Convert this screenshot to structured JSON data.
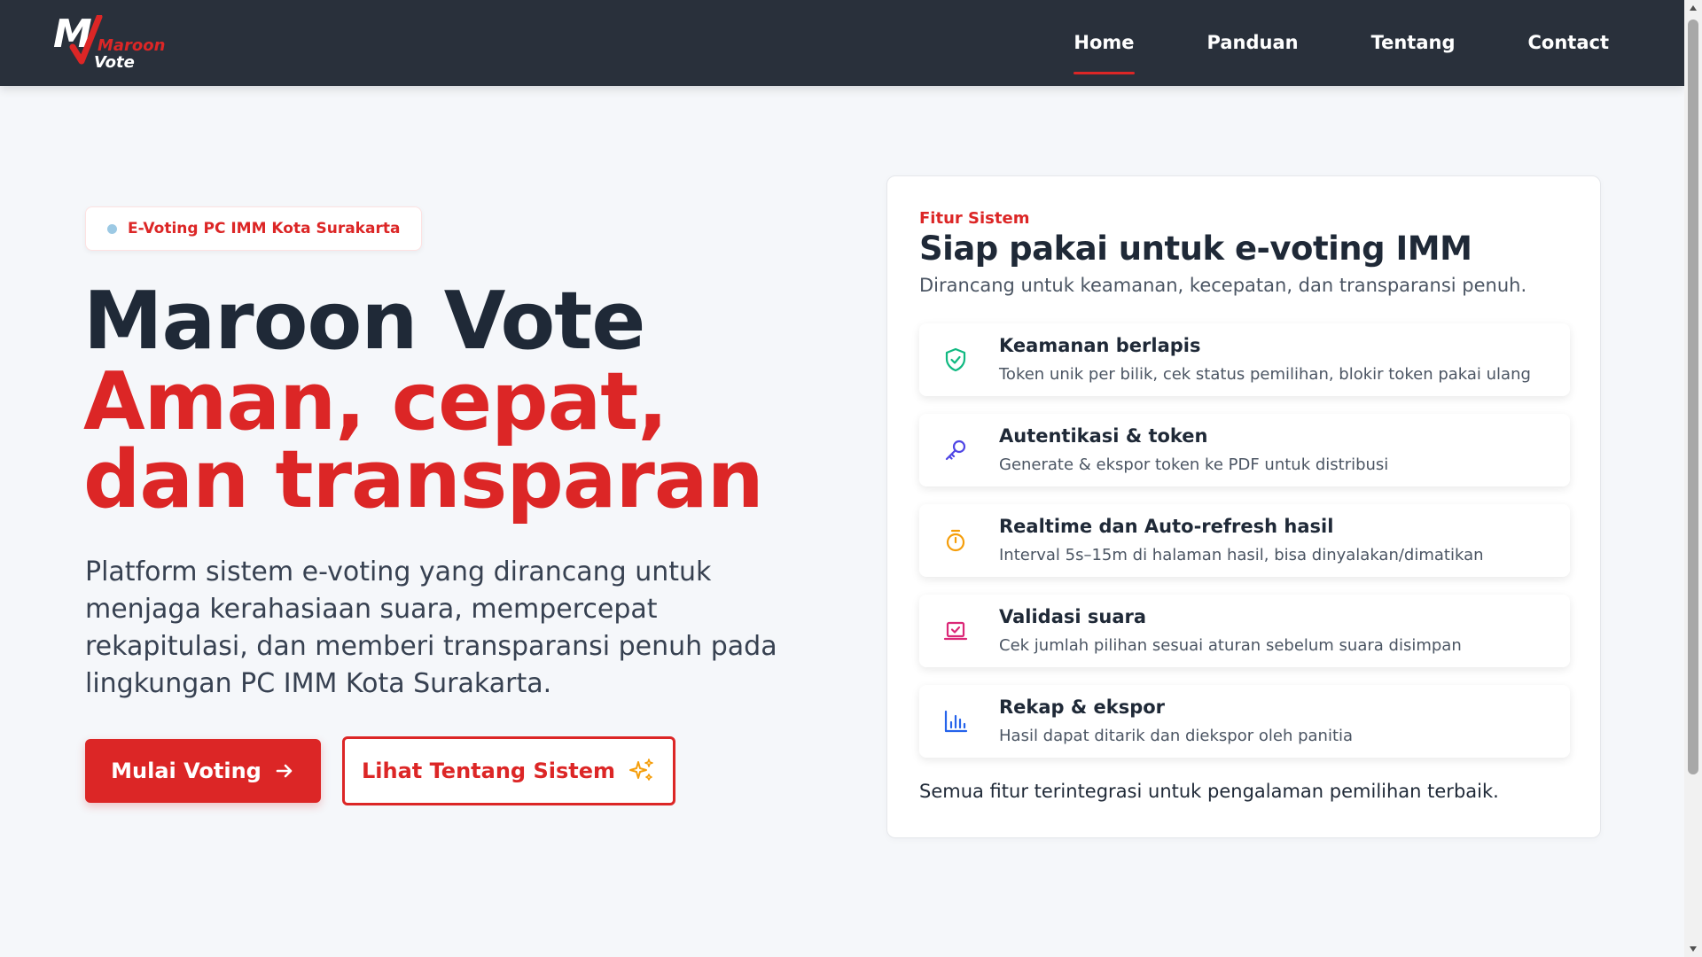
{
  "brand": {
    "logo_letter": "M",
    "logo_word_1": "Maroon",
    "logo_word_2": "Vote"
  },
  "nav": {
    "items": [
      "Home",
      "Panduan",
      "Tentang",
      "Contact"
    ],
    "active": "Home"
  },
  "hero": {
    "badge": "E-Voting PC IMM Kota Surakarta",
    "title": "Maroon Vote",
    "title_red": "Aman, cepat, dan transparan",
    "description": "Platform sistem e-voting yang dirancang untuk menjaga kerahasiaan suara, mempercepat rekapitulasi, dan memberi transparansi penuh pada lingkungan PC IMM Kota Surakarta.",
    "primary_button": "Mulai Voting",
    "secondary_button": "Lihat Tentang Sistem"
  },
  "card": {
    "kicker": "Fitur Sistem",
    "title": "Siap pakai untuk e-voting IMM",
    "subtitle": "Dirancang untuk keamanan, kecepatan, dan transparansi penuh.",
    "features": [
      {
        "title": "Keamanan berlapis",
        "desc": "Token unik per bilik, cek status pemilihan, blokir token pakai ulang",
        "icon": "shield-check-icon",
        "color": "#10b981"
      },
      {
        "title": "Autentikasi & token",
        "desc": "Generate & ekspor token ke PDF untuk distribusi",
        "icon": "key-icon",
        "color": "#4f46e5"
      },
      {
        "title": "Realtime dan Auto-refresh hasil",
        "desc": "Interval 5s–15m di halaman hasil, bisa dinyalakan/dimatikan",
        "icon": "stopwatch-icon",
        "color": "#f59e0b"
      },
      {
        "title": "Validasi suara",
        "desc": "Cek jumlah pilihan sesuai aturan sebelum suara disimpan",
        "icon": "ballot-check-icon",
        "color": "#db2777"
      },
      {
        "title": "Rekap & ekspor",
        "desc": "Hasil dapat ditarik dan diekspor oleh panitia",
        "icon": "bar-chart-icon",
        "color": "#2563eb"
      }
    ],
    "footer": "Semua fitur terintegrasi untuk pengalaman pemilihan terbaik."
  },
  "colors": {
    "primary": "#dc2626",
    "navbar": "#29303b",
    "background": "#f5f7fa"
  }
}
